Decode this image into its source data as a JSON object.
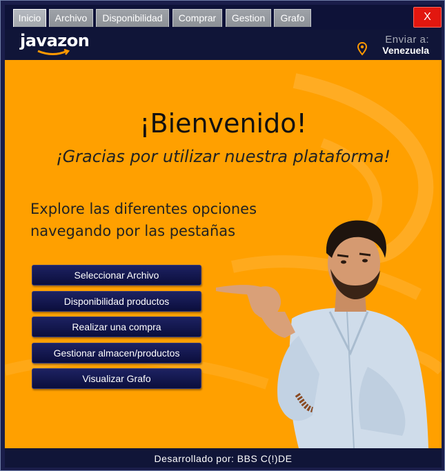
{
  "tabs": [
    {
      "label": "Inicio",
      "active": true
    },
    {
      "label": "Archivo",
      "active": false
    },
    {
      "label": "Disponibilidad",
      "active": false
    },
    {
      "label": "Comprar",
      "active": false
    },
    {
      "label": "Gestion",
      "active": false
    },
    {
      "label": "Grafo",
      "active": false
    }
  ],
  "window": {
    "close_label": "X"
  },
  "header": {
    "logo": "javazon",
    "ship_to_label": "Enviar a:",
    "ship_to_country": "Venezuela"
  },
  "main": {
    "title": "¡Bienvenido!",
    "subtitle": "¡Gracias por utilizar nuestra plataforma!",
    "explore_line1": "Explore las diferentes  opciones",
    "explore_line2": "navegando por las pestañas",
    "buttons": [
      {
        "label": "Seleccionar Archivo"
      },
      {
        "label": "Disponibilidad productos"
      },
      {
        "label": "Realizar una compra"
      },
      {
        "label": "Gestionar almacen/productos"
      },
      {
        "label": "Visualizar Grafo"
      }
    ]
  },
  "footer": {
    "text": "Desarrollado por: BBS C(!)DE"
  },
  "colors": {
    "accent_orange": "#ffa000",
    "navy": "#101538",
    "close_red": "#e2170f"
  },
  "icons": [
    "location-pin-icon",
    "logo-smile-arrow"
  ]
}
